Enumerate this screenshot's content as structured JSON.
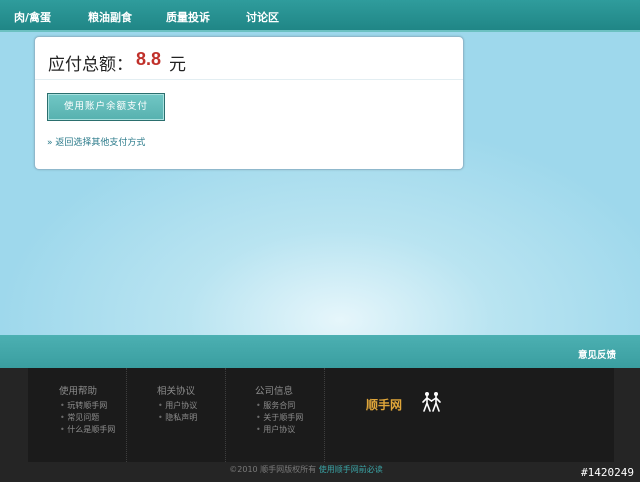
{
  "nav": {
    "items": [
      {
        "label": "肉/禽蛋"
      },
      {
        "label": "粮油副食"
      },
      {
        "label": "质量投诉"
      },
      {
        "label": "讨论区"
      }
    ]
  },
  "payment": {
    "amount_label": "应付总额：",
    "amount": "8.8",
    "currency_unit": "元",
    "pay_button_label": "使用账户余额支付",
    "back_link": "» 返回选择其他支付方式"
  },
  "feedback": {
    "label": "意见反馈"
  },
  "footer": {
    "columns": [
      {
        "title": "使用帮助",
        "links": [
          "玩转顺手网",
          "常见问题",
          "什么是顺手网"
        ]
      },
      {
        "title": "相关协议",
        "links": [
          "用户协议",
          "隐私声明"
        ]
      },
      {
        "title": "公司信息",
        "links": [
          "服务合同",
          "关于顺手网",
          "用户协议"
        ]
      }
    ],
    "brand_name": "顺手网",
    "copyright": "©2010 顺手网版权所有",
    "copyright_link": "使用顺手网前必读"
  },
  "watermark": "#1420249",
  "colors": {
    "nav_bg": "#228888",
    "amount": "#c0302a",
    "button": "#5fb8b6",
    "feedback_bar": "#43a8aa",
    "footer_bg": "#1b1b1b",
    "brand": "#e0a63a"
  },
  "icons": {
    "brand_logo": "walking-people-icon"
  }
}
